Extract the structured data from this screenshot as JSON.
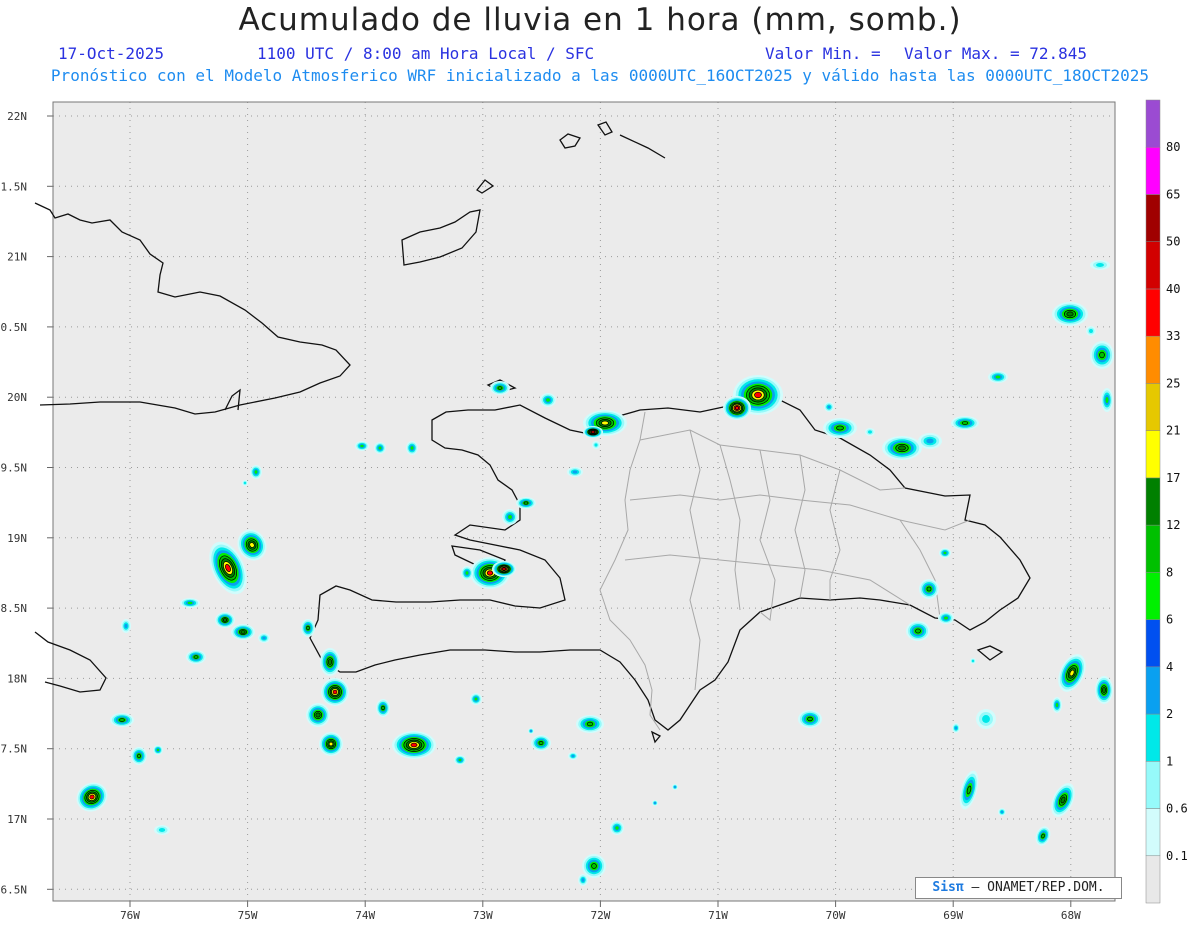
{
  "header": {
    "title": "Acumulado de lluvia en 1 hora (mm, somb.)",
    "date": "17-Oct-2025",
    "time": "1100 UTC / 8:00 am Hora Local / SFC",
    "valor_min": "Valor Min. =",
    "valor_max": "Valor Max. = 72.845",
    "subtitle": "Pronóstico con el Modelo Atmosferico WRF inicializado a las 0000UTC_16OCT2025 y válido hasta las  0000UTC_18OCT2025"
  },
  "lat_labels": [
    "22N",
    "1.5N",
    "21N",
    "0.5N",
    "20N",
    "9.5N",
    "19N",
    "8.5N",
    "18N",
    "7.5N",
    "17N",
    "6.5N"
  ],
  "lon_labels": [
    "76W",
    "75W",
    "74W",
    "73W",
    "72W",
    "71W",
    "70W",
    "69W",
    "68W"
  ],
  "legend": {
    "levels": [
      "0.1",
      "0.6",
      "1",
      "2",
      "4",
      "6",
      "8",
      "12",
      "17",
      "21",
      "25",
      "33",
      "40",
      "50",
      "65",
      "80"
    ],
    "colors": [
      "#e8e8e8",
      "#d2fcfc",
      "#96fafa",
      "#00e8e8",
      "#0aa0f0",
      "#0050f0",
      "#00f000",
      "#00c000",
      "#008000",
      "#ffff00",
      "#e6c800",
      "#ff8c00",
      "#ff0000",
      "#d20000",
      "#a00000",
      "#ff00ff",
      "#9b4bd2"
    ]
  },
  "credit": {
    "brand": "Sisπ",
    "text": "– ONAMET/REP.DOM."
  },
  "icons": {
    "coastline": "coastline-outline",
    "borders": "province-borders"
  }
}
